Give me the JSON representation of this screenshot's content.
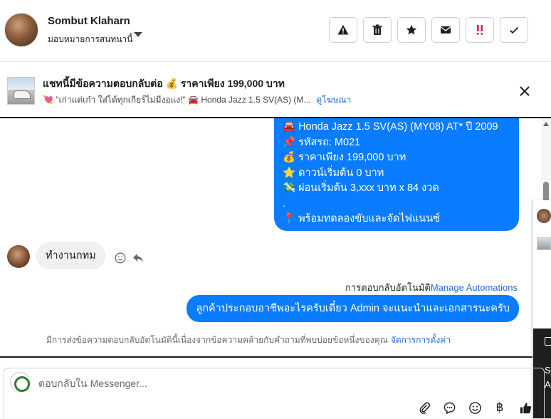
{
  "header": {
    "name": "Sombut Klaharn",
    "assign_label": "มอบหมายการสนทนานี้",
    "buttons": [
      {
        "icon": "warning-icon",
        "label": "Report"
      },
      {
        "icon": "trash-icon",
        "label": "Delete"
      },
      {
        "icon": "star-icon",
        "label": "Star"
      },
      {
        "icon": "mail-icon",
        "label": "Mark unread"
      },
      {
        "icon": "priority-icon",
        "label": "Priority"
      },
      {
        "icon": "check-icon",
        "label": "Done"
      }
    ]
  },
  "banner": {
    "title": "แชทนี้มีข้อความตอบกลับต่อ 💰 ราคาเพียง 199,000 บาท",
    "subtitle": "💘 \"เก่าแต่เก๋า ใส่ได้ทุกเกียร์ไม่มีงอแง!\" 🚘 Honda Jazz 1.5 SV(AS) (M...",
    "ad_label": "ดูโฆษณา"
  },
  "messages": {
    "card_lines": [
      "🚘  Honda Jazz 1.5 SV(AS) (MY08) AT* ปี 2009",
      "📌 รหัสรถ: M021",
      "💰 ราคาเพียง 199,000 บาท",
      "⭐ ดาวน์เริ่มต้น 0 บาท",
      "💸 ผ่อนเริ่มต้น 3,xxx บาท x 84 งวด",
      ".",
      "📍 พร้อมทดลองขับและจัดไฟแนนซ์"
    ],
    "incoming_text": "ทำงานกทม",
    "automation_label": "การตอบกลับอัตโนมัติ",
    "automation_link": "Manage Automations",
    "outgoing_text": "ลูกค้าประกอบอาชีพอะไรครับเดี๋ยว Admin จะแนะนำและเอกสารนะครับ",
    "notice_text": "มีการส่งข้อความตอบกลับอัตโนมัตินี้เนื่องจากข้อความคล้ายกับคำถามที่พบบ่อยข้อหนึ่งของคุณ",
    "notice_link": "จัดการการตั้งค่า"
  },
  "side_panel": {
    "line1": "S",
    "line2": "A"
  },
  "composer": {
    "placeholder": "ตอบกลับใน Messenger...",
    "icons": [
      "attach-icon",
      "saved-reply-icon",
      "emoji-icon",
      "baht-icon",
      "thumbs-up-icon"
    ],
    "currency_symbol": "฿"
  },
  "colors": {
    "accent": "#0a7cff",
    "link": "#216fdb",
    "priority": "#e41e3f"
  }
}
